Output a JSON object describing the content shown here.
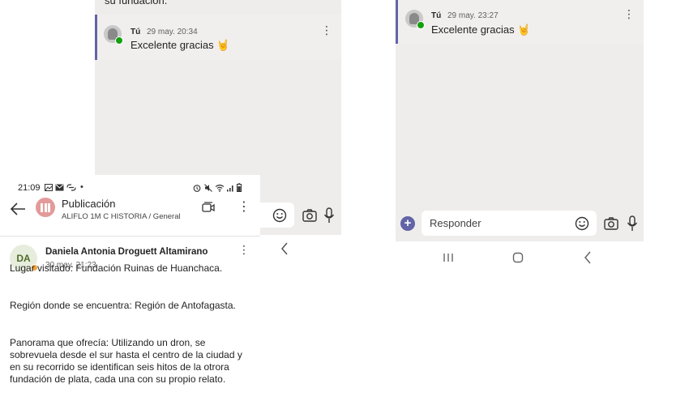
{
  "middle_panel": {
    "clipped_text": "su fundación.",
    "message": {
      "author": "Tú",
      "timestamp": "29 may. 20:34",
      "text": "Excelente gracias 🤘"
    }
  },
  "right_panel": {
    "message": {
      "author": "Tú",
      "timestamp": "29 may. 23:27",
      "text": "Excelente gracias 🤘"
    },
    "compose": {
      "placeholder": "Responder"
    }
  },
  "front_screen": {
    "status": {
      "time": "21:09",
      "dot": "•"
    },
    "header": {
      "title": "Publicación",
      "subtitle": "ALIFLO 1M C HISTORIA / General"
    },
    "post": {
      "avatar_initials": "DA",
      "author": "Daniela Antonia Droguett Altamirano",
      "date": "30 may. 21:23",
      "paragraphs": [
        "Lugar visitado: Fundación Ruinas de Huanchaca.",
        "Región donde se encuentra: Región de Antofagasta.",
        "Panorama que ofrecía: Utilizando un dron, se sobrevuela desde el sur hasta el centro de la ciudad y en su recorrido se identifican seis hitos de la otrora fundación de plata, cada una con su propio relato."
      ]
    }
  },
  "icons": {
    "accent_color": "#6264a7",
    "presence_color": "#13a10e"
  }
}
